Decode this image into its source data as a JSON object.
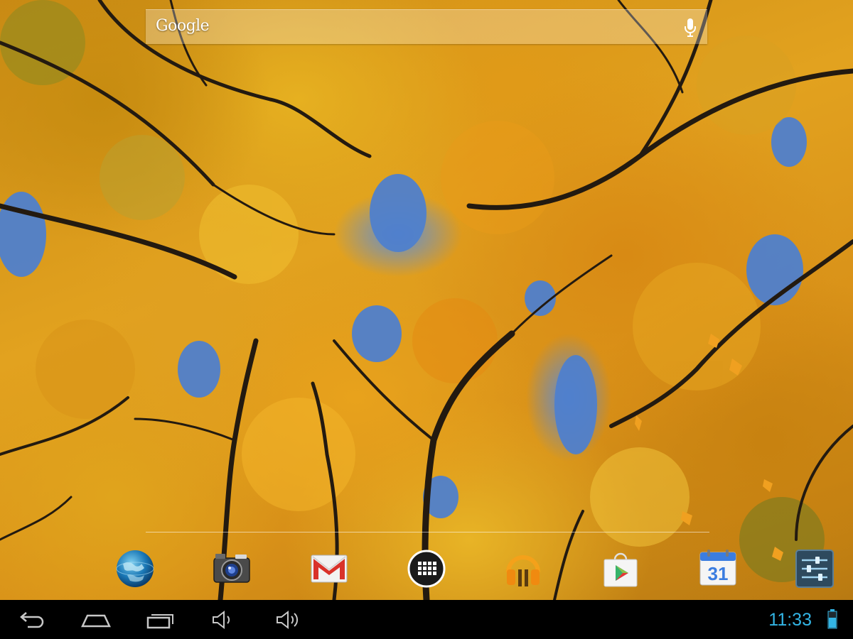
{
  "search": {
    "logo_text": "Google",
    "mic_icon": "microphone-icon"
  },
  "dock": {
    "items": [
      {
        "icon": "browser-globe-icon"
      },
      {
        "icon": "camera-icon"
      },
      {
        "icon": "gmail-icon"
      },
      {
        "icon": "all-apps-icon"
      },
      {
        "icon": "play-music-icon"
      },
      {
        "icon": "play-store-icon"
      },
      {
        "icon": "calendar-icon",
        "day": "31"
      },
      {
        "icon": "settings-icon"
      }
    ]
  },
  "navbar": {
    "buttons": [
      {
        "icon": "back-icon"
      },
      {
        "icon": "home-icon"
      },
      {
        "icon": "recent-apps-icon"
      },
      {
        "icon": "volume-down-icon"
      },
      {
        "icon": "volume-up-icon"
      }
    ],
    "clock": "11:33",
    "battery_icon": "battery-icon"
  },
  "colors": {
    "clock": "#33b5e5",
    "navbar_bg": "#000000",
    "wallpaper_leaves": "#e2a21f",
    "wallpaper_sky": "#4f7fc4"
  }
}
